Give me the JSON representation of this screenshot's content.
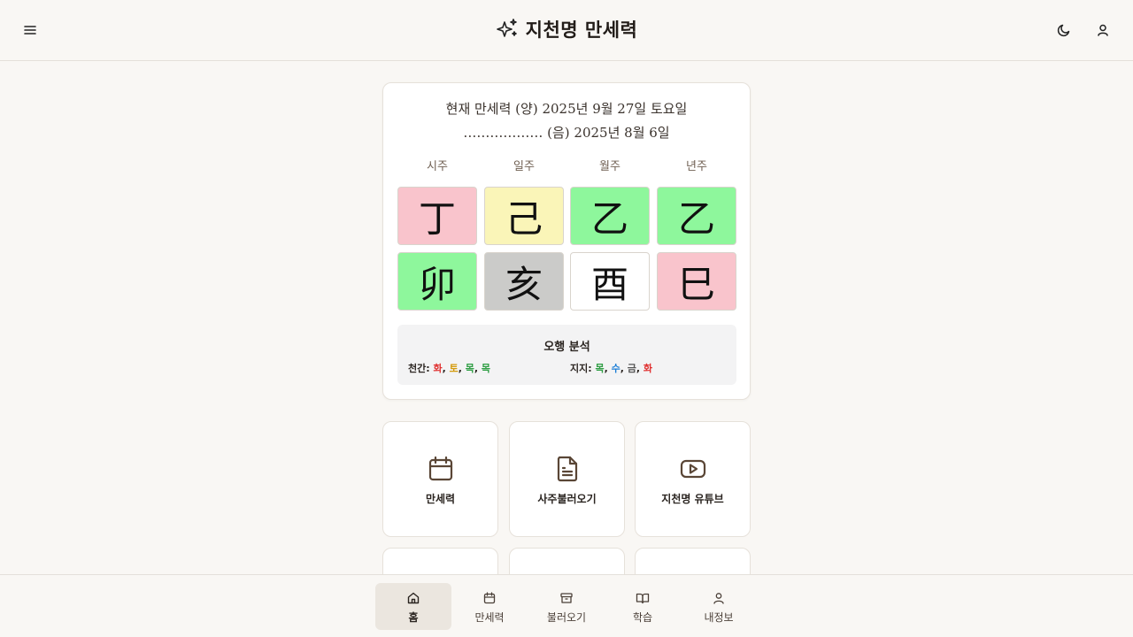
{
  "header": {
    "title": "지천명 만세력",
    "menu_icon": "menu-icon",
    "brand_icon": "sparkles-icon",
    "theme_icon": "moon-icon",
    "user_icon": "user-icon"
  },
  "calendar": {
    "solar_line": "현재 만세력 (양) 2025년 9월 27일 토요일",
    "lunar_line": "……………… (음) 2025년 8월 6일"
  },
  "pillars": {
    "labels": [
      "시주",
      "일주",
      "월주",
      "년주"
    ],
    "heavenly": [
      {
        "char": "丁",
        "color": "#f9c4cc"
      },
      {
        "char": "己",
        "color": "#faf5b8"
      },
      {
        "char": "乙",
        "color": "#8ef79c"
      },
      {
        "char": "乙",
        "color": "#8ef79c"
      }
    ],
    "earthly": [
      {
        "char": "卯",
        "color": "#8ef79c"
      },
      {
        "char": "亥",
        "color": "#cbcbc9"
      },
      {
        "char": "酉",
        "color": "#ffffff"
      },
      {
        "char": "巳",
        "color": "#f9c4cc"
      }
    ]
  },
  "analysis": {
    "title": "오행 분석",
    "stems_label": "천간:",
    "stems": [
      {
        "text": "화",
        "color": "#e03131"
      },
      {
        "text": "토",
        "color": "#d49a0b"
      },
      {
        "text": "목",
        "color": "#2f9e44"
      },
      {
        "text": "목",
        "color": "#2f9e44"
      }
    ],
    "branches_label": "지지:",
    "branches": [
      {
        "text": "목",
        "color": "#2f9e44"
      },
      {
        "text": "수",
        "color": "#1c7ed6"
      },
      {
        "text": "금",
        "color": "#555555"
      },
      {
        "text": "화",
        "color": "#e03131"
      }
    ]
  },
  "tiles": [
    {
      "label": "만세력",
      "icon": "calendar-icon"
    },
    {
      "label": "사주불러오기",
      "icon": "file-text-icon"
    },
    {
      "label": "지천명 유튜브",
      "icon": "youtube-icon"
    }
  ],
  "bottom_nav": [
    {
      "label": "홈",
      "icon": "home-icon",
      "active": true
    },
    {
      "label": "만세력",
      "icon": "calendar-icon",
      "active": false
    },
    {
      "label": "불러오기",
      "icon": "archive-icon",
      "active": false
    },
    {
      "label": "학습",
      "icon": "book-open-icon",
      "active": false
    },
    {
      "label": "내정보",
      "icon": "user-icon",
      "active": false
    }
  ],
  "colors": {
    "background": "#f9f7f4",
    "accent_brown": "#5a4636"
  }
}
